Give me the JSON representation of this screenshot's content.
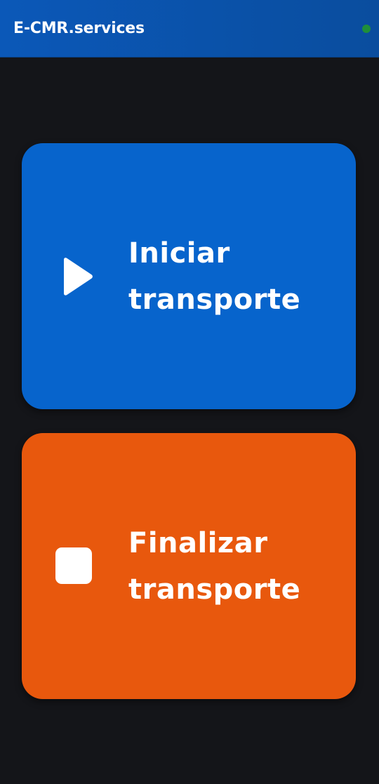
{
  "app_bar": {
    "title": "E-CMR.services",
    "status_indicator_color": "#1f8f3a",
    "background_color": "#0b58b8"
  },
  "actions": [
    {
      "line1": "Iniciar",
      "line2": "transporte",
      "icon": "play-icon",
      "color": "#0764cc"
    },
    {
      "line1": "Finalizar",
      "line2": "transporte",
      "icon": "stop-icon",
      "color": "#e8580d"
    }
  ]
}
